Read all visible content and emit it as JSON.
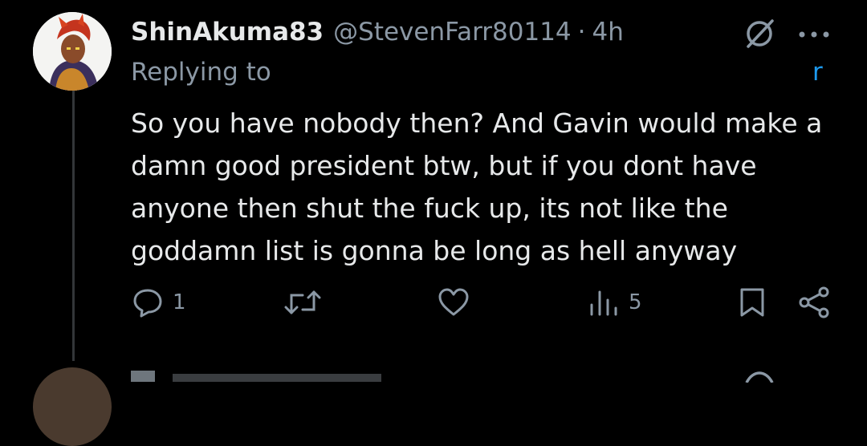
{
  "tweet": {
    "display_name": "ShinAkuma83",
    "handle": "@StevenFarr80114",
    "separator": "·",
    "time": "4h",
    "replying_to_label": "Replying to",
    "mention_visible_tail": "r",
    "body_lines": [
      "So you have nobody then? And Gavin would make a",
      "damn good president btw, but if you dont have",
      "anyone then shut the fuck up, its not like the",
      "goddamn list is gonna be long as hell anyway"
    ],
    "actions": {
      "reply_count": "1",
      "retweet_count": "",
      "like_count": "",
      "views_count": "5"
    }
  },
  "icons": {
    "reply": "reply-icon",
    "retweet": "retweet-icon",
    "like": "heart-icon",
    "views": "views-icon",
    "bookmark": "bookmark-icon",
    "share": "share-icon",
    "grok": "grok-icon",
    "more": "more-icon"
  },
  "colors": {
    "background": "#000000",
    "text": "#e7e9ea",
    "muted": "#8b98a5",
    "link": "#1d9bf0"
  }
}
